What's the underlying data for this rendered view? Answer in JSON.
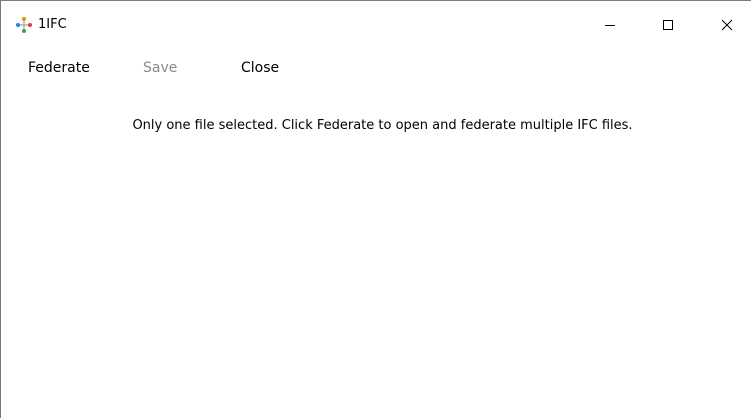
{
  "window": {
    "title": "1IFC",
    "app_icon": "federation-network-icon"
  },
  "caption_buttons": {
    "minimize_icon": "minimize-icon",
    "maximize_icon": "maximize-icon",
    "close_icon": "close-icon"
  },
  "menu": {
    "federate": "Federate",
    "save": "Save",
    "close": "Close"
  },
  "main": {
    "message": "Only one file selected. Click Federate to open and federate multiple IFC files."
  },
  "colors": {
    "background": "#ffffff",
    "disabled_text": "#8a8a8a",
    "icon_red": "#e53935",
    "icon_blue": "#1e88e5",
    "icon_green": "#43a047",
    "icon_orange": "#fb8c00"
  }
}
